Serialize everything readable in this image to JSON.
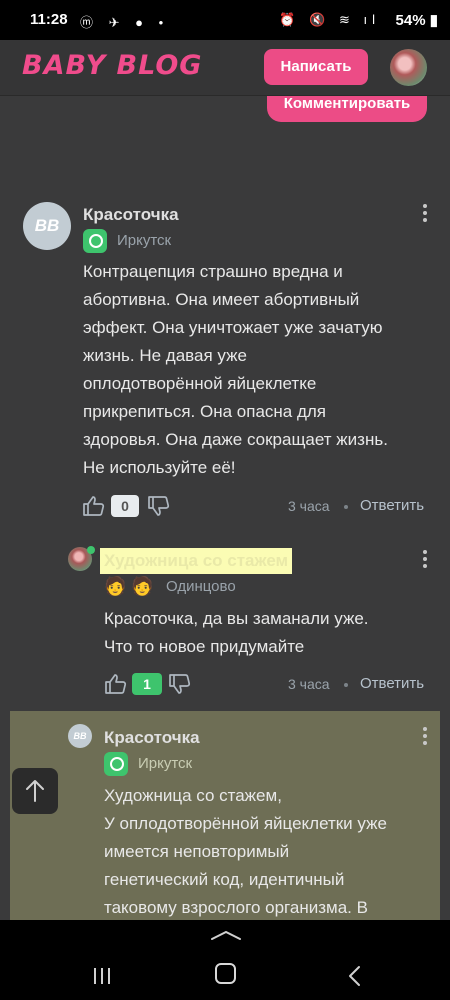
{
  "status_bar": {
    "time": "11:28",
    "battery": "54%",
    "left_icons": "ⓜ ✈ ● •",
    "right_icons": "⏰ 🔇 ≋ ıl"
  },
  "header": {
    "logo": "BABY BLOG",
    "write_button": "Написать"
  },
  "comment_button": "Комментировать",
  "comments": [
    {
      "avatar_text": "BB",
      "author": "Красоточка",
      "city": "Иркутск",
      "text_lines": [
        "Контрацепция страшно вредна и",
        "абортивна. Она имеет абортивный",
        "эффект. Она уничтожает уже зачатую",
        "жизнь. Не давая уже",
        "оплодотворённой яйцеклетке",
        "прикрепиться. Она опасна для",
        "здоровья. Она даже сокращает жизнь.",
        "Не используйте её!"
      ],
      "likes": "0",
      "time": "3 часа",
      "reply": "Ответить"
    },
    {
      "author": "Художница со стажем",
      "emojis": "🧑 🧑",
      "city": "Одинцово",
      "text_lines": [
        "Красоточка, да вы заманали уже.",
        "Что то новое придумайте"
      ],
      "likes": "1",
      "time": "3 часа",
      "reply": "Ответить"
    },
    {
      "avatar_text": "BB",
      "author": "Красоточка",
      "city": "Иркутск",
      "text_lines": [
        "Художница со стажем,",
        "У оплодотворённой яйцеклетки уже",
        "имеется неповторимый",
        "генетический код, идентичный",
        "таковому взрослого организма. В"
      ]
    }
  ],
  "colors": {
    "accent": "#ec4c86",
    "city_icon": "#3ec46d",
    "highlight": "#6e6e55",
    "likes_active": "#3ec46d"
  },
  "icons": [
    "thumb-up-icon",
    "thumb-down-icon",
    "arrow-up-icon",
    "kebab-icon",
    "clock-icon"
  ]
}
